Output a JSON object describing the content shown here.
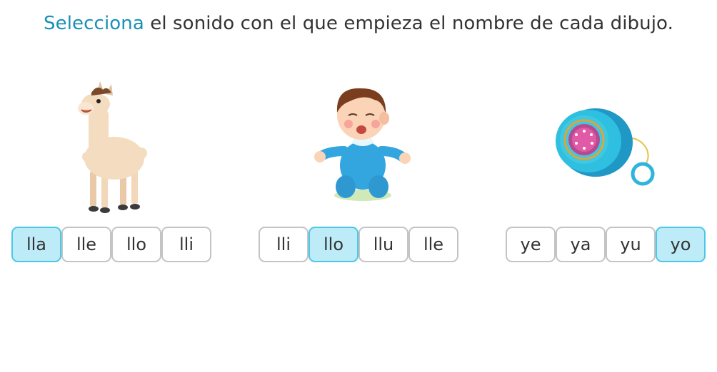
{
  "instruction": {
    "highlight": "Selecciona",
    "rest": " el sonido con el que empieza el nombre de cada dibujo."
  },
  "groups": [
    {
      "picture": "llama-image",
      "options": [
        "lla",
        "lle",
        "llo",
        "lli"
      ],
      "selected": "lla"
    },
    {
      "picture": "baby-image",
      "options": [
        "lli",
        "llo",
        "llu",
        "lle"
      ],
      "selected": "llo"
    },
    {
      "picture": "yoyo-image",
      "options": [
        "ye",
        "ya",
        "yu",
        "yo"
      ],
      "selected": "yo"
    }
  ],
  "colors": {
    "accent": "#1a8fb5",
    "selected_bg": "#bdebf7",
    "selected_border": "#4cc8e6",
    "border": "#c4c4c4"
  }
}
